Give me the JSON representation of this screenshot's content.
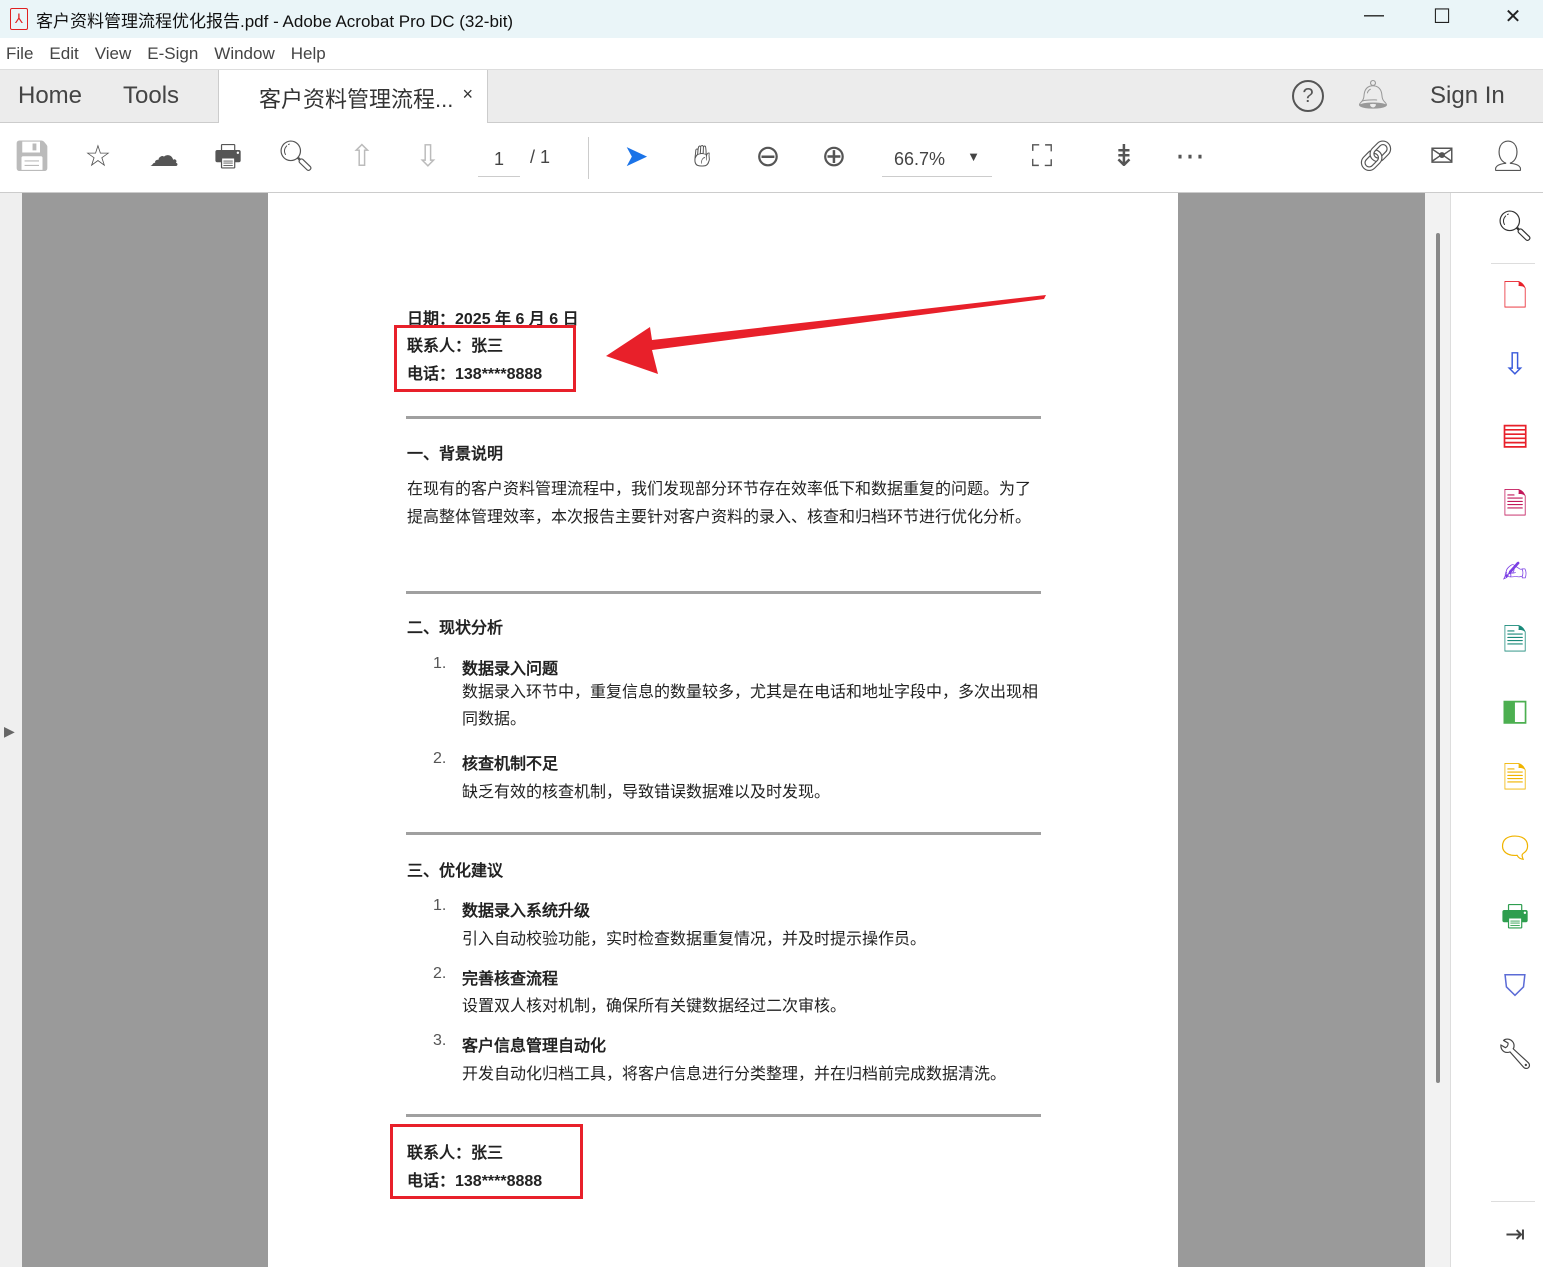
{
  "window": {
    "title": "客户资料管理流程优化报告.pdf - Adobe Acrobat Pro DC (32-bit)",
    "minimize": "—",
    "maximize": "☐",
    "close": "✕"
  },
  "menu": [
    "File",
    "Edit",
    "View",
    "E-Sign",
    "Window",
    "Help"
  ],
  "tabs": {
    "home": "Home",
    "tools": "Tools",
    "doc": "客户资料管理流程...",
    "close": "×"
  },
  "header": {
    "sign_in": "Sign In"
  },
  "toolbar": {
    "page_current": "1",
    "page_total": "/ 1",
    "zoom": "66.7%"
  },
  "document": {
    "date": "日期：2025 年 6 月 6 日",
    "contact": "联系人：张三",
    "phone": "电话：138****8888",
    "s1_title": "一、背景说明",
    "s1_body": "在现有的客户资料管理流程中，我们发现部分环节存在效率低下和数据重复的问题。为了提高整体管理效率，本次报告主要针对客户资料的录入、核查和归档环节进行优化分析。",
    "s2_title": "二、现状分析",
    "s2_items": [
      {
        "num": "1.",
        "title": "数据录入问题",
        "body": "数据录入环节中，重复信息的数量较多，尤其是在电话和地址字段中，多次出现相同数据。"
      },
      {
        "num": "2.",
        "title": "核查机制不足",
        "body": "缺乏有效的核查机制，导致错误数据难以及时发现。"
      }
    ],
    "s3_title": "三、优化建议",
    "s3_items": [
      {
        "num": "1.",
        "title": "数据录入系统升级",
        "body": "引入自动校验功能，实时检查数据重复情况，并及时提示操作员。"
      },
      {
        "num": "2.",
        "title": "完善核查流程",
        "body": "设置双人核对机制，确保所有关键数据经过二次审核。"
      },
      {
        "num": "3.",
        "title": "客户信息管理自动化",
        "body": "开发自动化归档工具，将客户信息进行分类整理，并在归档前完成数据清洗。"
      }
    ],
    "footer_contact": "联系人：张三",
    "footer_phone": "电话：138****8888"
  },
  "colors": {
    "annotation": "#e8202a",
    "accent": "#1a73e8"
  }
}
